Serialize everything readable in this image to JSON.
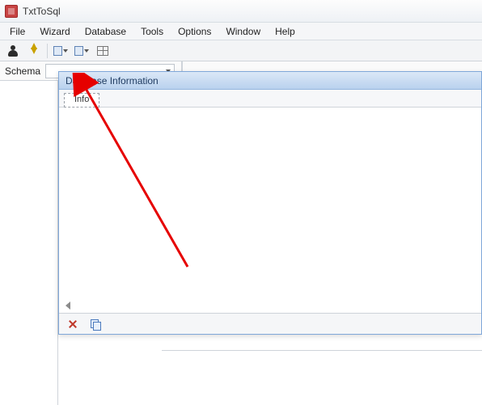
{
  "app": {
    "title": "TxtToSql"
  },
  "menu": {
    "items": [
      "File",
      "Wizard",
      "Database",
      "Tools",
      "Options",
      "Window",
      "Help"
    ]
  },
  "toolbar": {
    "icons": [
      "person",
      "flash",
      "box",
      "box",
      "grid"
    ]
  },
  "schema": {
    "label": "Schema"
  },
  "child_window": {
    "title": "Database Information",
    "tab_label": "Info"
  }
}
